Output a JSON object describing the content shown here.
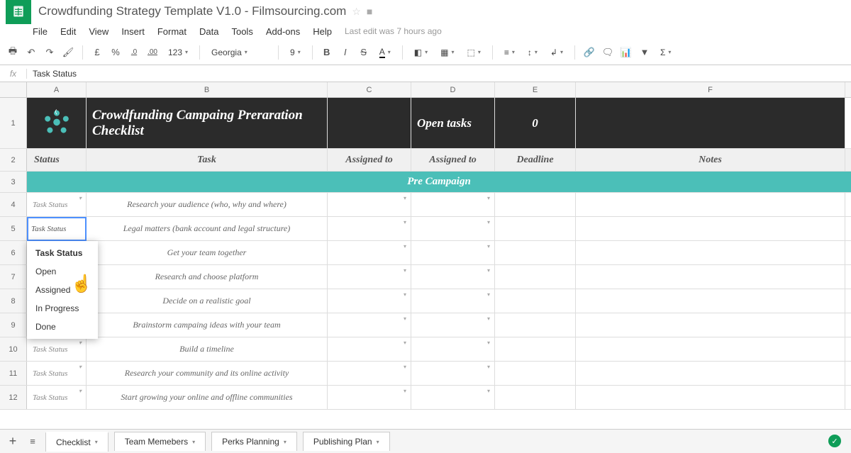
{
  "doc": {
    "title": "Crowdfunding Strategy Template V1.0 - Filmsourcing.com"
  },
  "menu": {
    "file": "File",
    "edit": "Edit",
    "view": "View",
    "insert": "Insert",
    "format": "Format",
    "data": "Data",
    "tools": "Tools",
    "addons": "Add-ons",
    "help": "Help",
    "last_edit": "Last edit was 7 hours ago"
  },
  "toolbar": {
    "currency": "£",
    "percent": "%",
    "dec1": ".0",
    "dec2": ".00",
    "numfmt": "123",
    "font": "Georgia",
    "size": "9",
    "bold": "B",
    "italic": "I",
    "strike": "S",
    "underline": "A",
    "sigma": "Σ"
  },
  "fx": {
    "label": "fx",
    "value": "Task Status"
  },
  "cols": {
    "A": "A",
    "B": "B",
    "C": "C",
    "D": "D",
    "E": "E",
    "F": "F"
  },
  "rows": [
    "1",
    "2",
    "3",
    "4",
    "5",
    "6",
    "7",
    "8",
    "9",
    "10",
    "11",
    "12"
  ],
  "header_row": {
    "title": "Crowdfunding Campaing Preraration Checklist",
    "open_tasks": "Open tasks",
    "count": "0"
  },
  "labels_row": {
    "status": "Status",
    "task": "Task",
    "assigned1": "Assigned to",
    "assigned2": "Assigned to",
    "deadline": "Deadline",
    "notes": "Notes"
  },
  "section": {
    "title": "Pre Campaign"
  },
  "tasks": [
    {
      "status": "Task Status",
      "task": "Research your audience (who, why and where)"
    },
    {
      "status": "",
      "task": "Legal matters (bank account and legal structure)"
    },
    {
      "status": "",
      "task": "Get your team together"
    },
    {
      "status": "",
      "task": "Research and choose platform"
    },
    {
      "status": "",
      "task": "Decide on a realistic goal"
    },
    {
      "status": "Task Status",
      "task": "Brainstorm campaing ideas with your team"
    },
    {
      "status": "Task Status",
      "task": "Build a timeline"
    },
    {
      "status": "Task Status",
      "task": "Research your community and its online activity"
    },
    {
      "status": "Task Status",
      "task": "Start growing your online and offline communities"
    }
  ],
  "edit_value": "Task Status",
  "dropdown": {
    "header": "Task Status",
    "items": [
      "Open",
      "Assigned",
      "In Progress",
      "Done"
    ]
  },
  "tabs": {
    "add": "+",
    "all": "≡",
    "t1": "Checklist",
    "t2": "Team Memebers",
    "t3": "Perks Planning",
    "t4": "Publishing Plan"
  }
}
